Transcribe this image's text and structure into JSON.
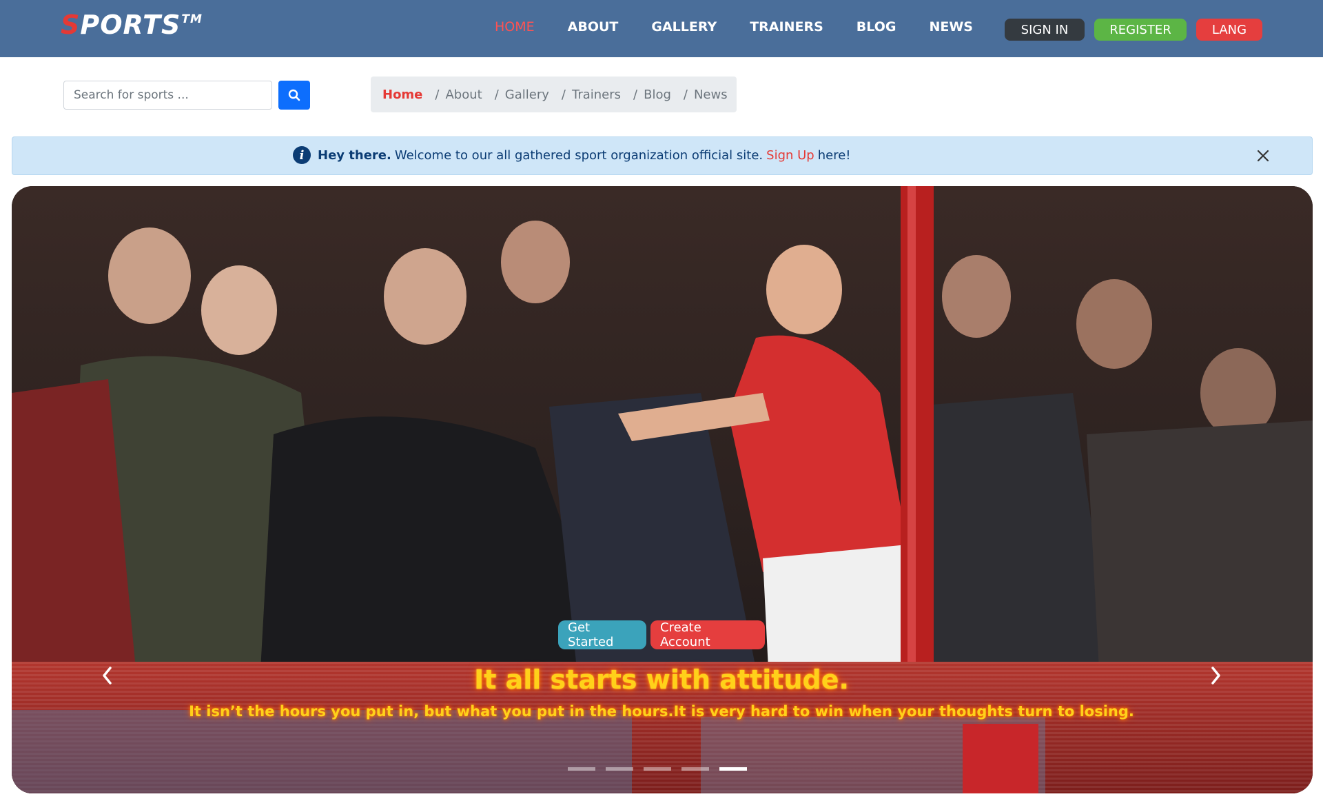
{
  "brand": {
    "first_letter": "S",
    "rest": "PORTS",
    "tm": "TM"
  },
  "nav": {
    "links": [
      {
        "label": "HOME"
      },
      {
        "label": "ABOUT"
      },
      {
        "label": "GALLERY"
      },
      {
        "label": "TRAINERS"
      },
      {
        "label": "BLOG"
      },
      {
        "label": "NEWS"
      }
    ],
    "active_index": 0,
    "sign_in": "SIGN IN",
    "register": "REGISTER",
    "lang": "LANG"
  },
  "search": {
    "placeholder": "Search for sports ...",
    "value": ""
  },
  "breadcrumb": {
    "items": [
      {
        "label": "Home"
      },
      {
        "label": "About"
      },
      {
        "label": "Gallery"
      },
      {
        "label": "Trainers"
      },
      {
        "label": "Blog"
      },
      {
        "label": "News"
      }
    ],
    "separator": "/"
  },
  "alert": {
    "icon": "info-icon",
    "strong": "Hey there.",
    "text": "Welcome to our all gathered sport organization official site.",
    "link": "Sign Up",
    "tail": "here!"
  },
  "hero": {
    "get_started": "Get Started",
    "create_account": "Create Account",
    "title": "It all starts with attitude.",
    "subtitle": "It isn’t the hours you put in, but what you put in the hours.It is very hard to win when your thoughts turn to losing.",
    "slide_count": 5,
    "active_slide": 5
  },
  "colors": {
    "navbar": "#4a6e9a",
    "accent_red": "#e53935",
    "register_green": "#5cb545",
    "search_blue": "#0d6efd",
    "alert_bg": "#cfe6f8",
    "hero_text": "#ffd11a"
  }
}
